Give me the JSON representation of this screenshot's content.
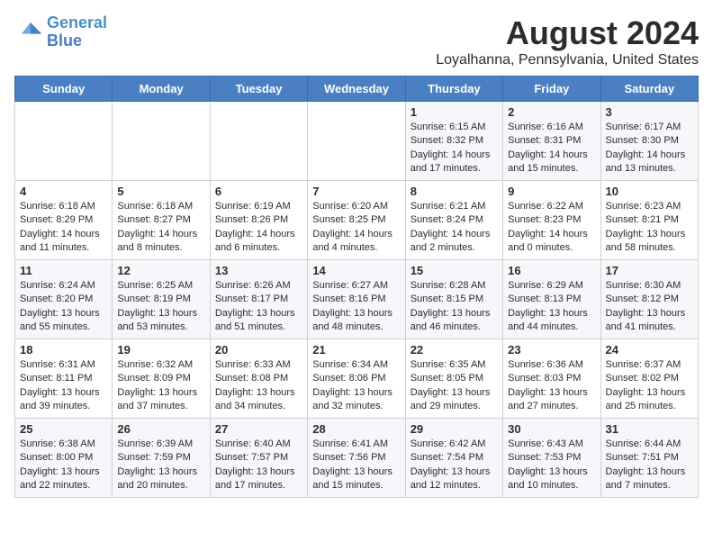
{
  "header": {
    "logo_line1": "General",
    "logo_line2": "Blue",
    "main_title": "August 2024",
    "subtitle": "Loyalhanna, Pennsylvania, United States"
  },
  "days_of_week": [
    "Sunday",
    "Monday",
    "Tuesday",
    "Wednesday",
    "Thursday",
    "Friday",
    "Saturday"
  ],
  "weeks": [
    [
      {
        "day": "",
        "content": ""
      },
      {
        "day": "",
        "content": ""
      },
      {
        "day": "",
        "content": ""
      },
      {
        "day": "",
        "content": ""
      },
      {
        "day": "1",
        "content": "Sunrise: 6:15 AM\nSunset: 8:32 PM\nDaylight: 14 hours\nand 17 minutes."
      },
      {
        "day": "2",
        "content": "Sunrise: 6:16 AM\nSunset: 8:31 PM\nDaylight: 14 hours\nand 15 minutes."
      },
      {
        "day": "3",
        "content": "Sunrise: 6:17 AM\nSunset: 8:30 PM\nDaylight: 14 hours\nand 13 minutes."
      }
    ],
    [
      {
        "day": "4",
        "content": "Sunrise: 6:18 AM\nSunset: 8:29 PM\nDaylight: 14 hours\nand 11 minutes."
      },
      {
        "day": "5",
        "content": "Sunrise: 6:18 AM\nSunset: 8:27 PM\nDaylight: 14 hours\nand 8 minutes."
      },
      {
        "day": "6",
        "content": "Sunrise: 6:19 AM\nSunset: 8:26 PM\nDaylight: 14 hours\nand 6 minutes."
      },
      {
        "day": "7",
        "content": "Sunrise: 6:20 AM\nSunset: 8:25 PM\nDaylight: 14 hours\nand 4 minutes."
      },
      {
        "day": "8",
        "content": "Sunrise: 6:21 AM\nSunset: 8:24 PM\nDaylight: 14 hours\nand 2 minutes."
      },
      {
        "day": "9",
        "content": "Sunrise: 6:22 AM\nSunset: 8:23 PM\nDaylight: 14 hours\nand 0 minutes."
      },
      {
        "day": "10",
        "content": "Sunrise: 6:23 AM\nSunset: 8:21 PM\nDaylight: 13 hours\nand 58 minutes."
      }
    ],
    [
      {
        "day": "11",
        "content": "Sunrise: 6:24 AM\nSunset: 8:20 PM\nDaylight: 13 hours\nand 55 minutes."
      },
      {
        "day": "12",
        "content": "Sunrise: 6:25 AM\nSunset: 8:19 PM\nDaylight: 13 hours\nand 53 minutes."
      },
      {
        "day": "13",
        "content": "Sunrise: 6:26 AM\nSunset: 8:17 PM\nDaylight: 13 hours\nand 51 minutes."
      },
      {
        "day": "14",
        "content": "Sunrise: 6:27 AM\nSunset: 8:16 PM\nDaylight: 13 hours\nand 48 minutes."
      },
      {
        "day": "15",
        "content": "Sunrise: 6:28 AM\nSunset: 8:15 PM\nDaylight: 13 hours\nand 46 minutes."
      },
      {
        "day": "16",
        "content": "Sunrise: 6:29 AM\nSunset: 8:13 PM\nDaylight: 13 hours\nand 44 minutes."
      },
      {
        "day": "17",
        "content": "Sunrise: 6:30 AM\nSunset: 8:12 PM\nDaylight: 13 hours\nand 41 minutes."
      }
    ],
    [
      {
        "day": "18",
        "content": "Sunrise: 6:31 AM\nSunset: 8:11 PM\nDaylight: 13 hours\nand 39 minutes."
      },
      {
        "day": "19",
        "content": "Sunrise: 6:32 AM\nSunset: 8:09 PM\nDaylight: 13 hours\nand 37 minutes."
      },
      {
        "day": "20",
        "content": "Sunrise: 6:33 AM\nSunset: 8:08 PM\nDaylight: 13 hours\nand 34 minutes."
      },
      {
        "day": "21",
        "content": "Sunrise: 6:34 AM\nSunset: 8:06 PM\nDaylight: 13 hours\nand 32 minutes."
      },
      {
        "day": "22",
        "content": "Sunrise: 6:35 AM\nSunset: 8:05 PM\nDaylight: 13 hours\nand 29 minutes."
      },
      {
        "day": "23",
        "content": "Sunrise: 6:36 AM\nSunset: 8:03 PM\nDaylight: 13 hours\nand 27 minutes."
      },
      {
        "day": "24",
        "content": "Sunrise: 6:37 AM\nSunset: 8:02 PM\nDaylight: 13 hours\nand 25 minutes."
      }
    ],
    [
      {
        "day": "25",
        "content": "Sunrise: 6:38 AM\nSunset: 8:00 PM\nDaylight: 13 hours\nand 22 minutes."
      },
      {
        "day": "26",
        "content": "Sunrise: 6:39 AM\nSunset: 7:59 PM\nDaylight: 13 hours\nand 20 minutes."
      },
      {
        "day": "27",
        "content": "Sunrise: 6:40 AM\nSunset: 7:57 PM\nDaylight: 13 hours\nand 17 minutes."
      },
      {
        "day": "28",
        "content": "Sunrise: 6:41 AM\nSunset: 7:56 PM\nDaylight: 13 hours\nand 15 minutes."
      },
      {
        "day": "29",
        "content": "Sunrise: 6:42 AM\nSunset: 7:54 PM\nDaylight: 13 hours\nand 12 minutes."
      },
      {
        "day": "30",
        "content": "Sunrise: 6:43 AM\nSunset: 7:53 PM\nDaylight: 13 hours\nand 10 minutes."
      },
      {
        "day": "31",
        "content": "Sunrise: 6:44 AM\nSunset: 7:51 PM\nDaylight: 13 hours\nand 7 minutes."
      }
    ]
  ]
}
